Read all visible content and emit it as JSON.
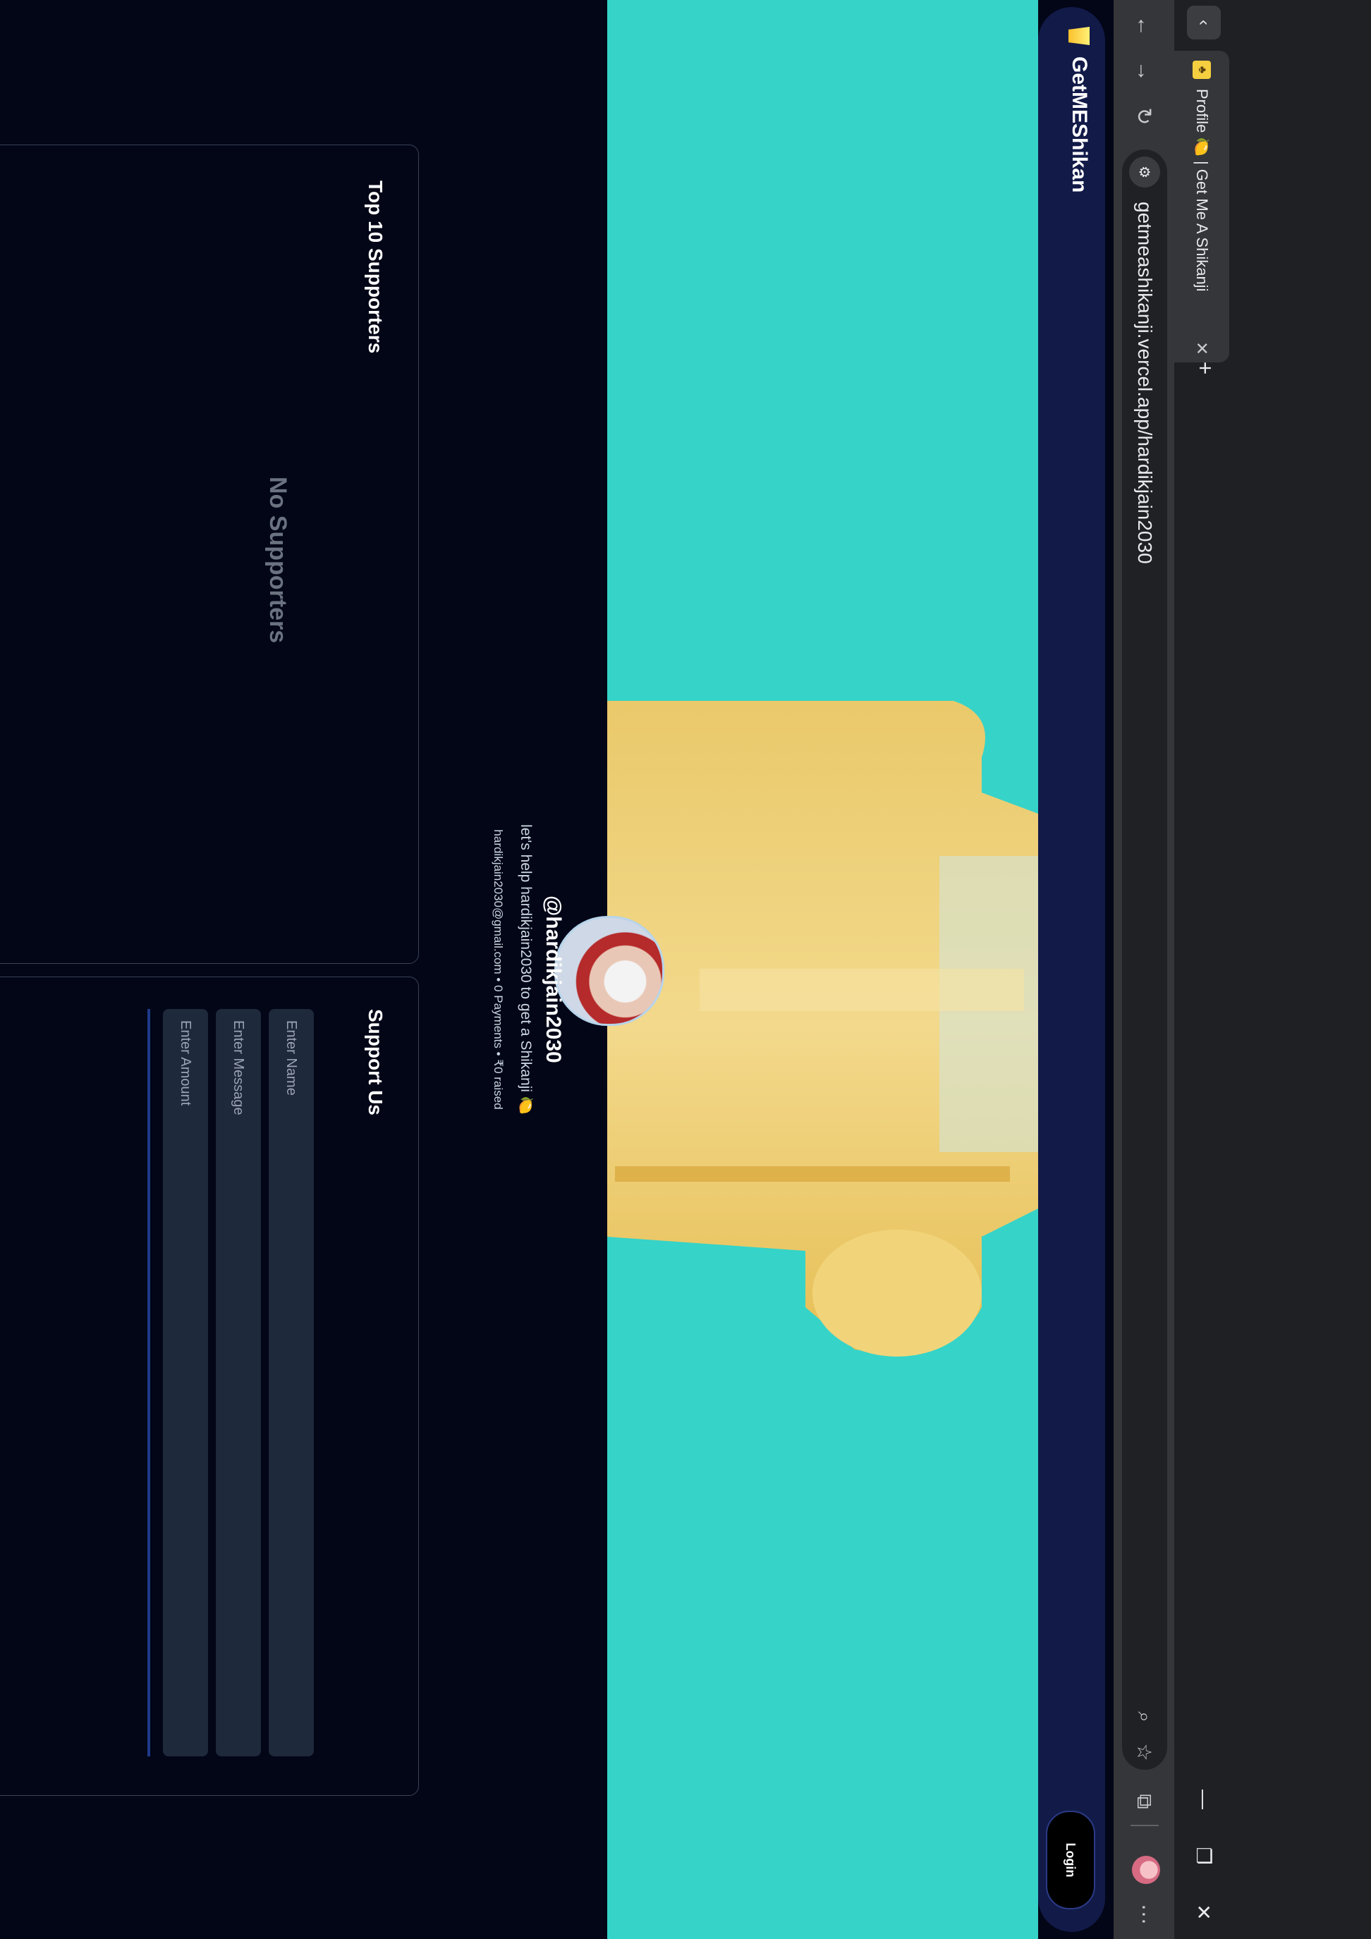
{
  "browser": {
    "tab_title": "Profile 🍋 | Get Me A Shikanji",
    "tab_close": "✕",
    "new_tab": "+",
    "back_tabs": "‹",
    "url": "getmeashikanji.vercel.app/hardikjain2030",
    "window_controls": {
      "minimize": "—",
      "restore": "❐",
      "close": "✕"
    },
    "nav_icons": [
      "up-arrow-icon",
      "down-arrow-icon",
      "reload-icon"
    ],
    "omnibox_icons": [
      "zoom-icon",
      "bookmark-star-icon",
      "extensions-icon",
      "more-menu-icon"
    ]
  },
  "site": {
    "brand": "GetMEShikan",
    "login": "Login"
  },
  "profile": {
    "handle": "@hardikjain2030",
    "tagline": "let's help hardikjain2030 to get a Shikanji 🍋",
    "stats": "hardikjain2030@gmail.com • 0 Payments • ₹0 raised"
  },
  "supporters": {
    "title": "Top 10 Supporters",
    "empty": "No Supporters"
  },
  "support_form": {
    "title": "Support Us",
    "name_placeholder": "Enter Name",
    "message_placeholder": "Enter Message",
    "amount_placeholder": "Enter Amount"
  },
  "colors": {
    "page_bg": "#020617",
    "navbar_bg": "#121a48",
    "cover_bg": "#36d3c8",
    "input_bg": "#1e293b",
    "card_border": "#3b4358"
  }
}
